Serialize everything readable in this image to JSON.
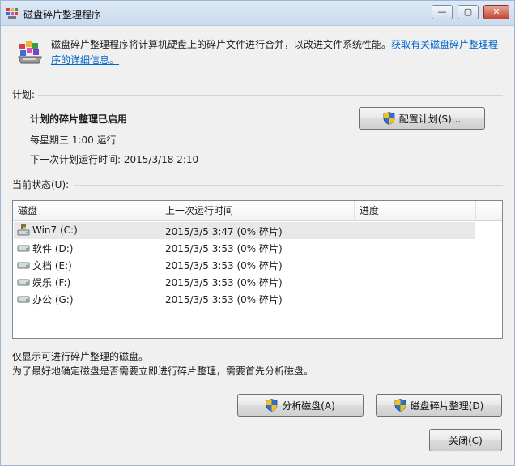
{
  "window": {
    "title": "磁盘碎片整理程序"
  },
  "caption": {
    "minimize": "—",
    "maximize": "▢",
    "close": "✕"
  },
  "description": {
    "text": "磁盘碎片整理程序将计算机硬盘上的碎片文件进行合并，以改进文件系统性能。",
    "link": "获取有关磁盘碎片整理程序的详细信息。"
  },
  "schedule": {
    "group_label": "计划:",
    "enabled_text": "计划的碎片整理已启用",
    "frequency": "每星期三  1:00 运行",
    "next_run": "下一次计划运行时间: 2015/3/18 2:10",
    "configure_button": "配置计划(S)..."
  },
  "status": {
    "group_label": "当前状态(U):",
    "columns": [
      "磁盘",
      "上一次运行时间",
      "进度"
    ],
    "rows": [
      {
        "name": "Win7 (C:)",
        "last_run": "2015/3/5 3:47 (0% 碎片)",
        "progress": "",
        "icon": "system-drive-icon"
      },
      {
        "name": "软件 (D:)",
        "last_run": "2015/3/5 3:53 (0% 碎片)",
        "progress": "",
        "icon": "hard-drive-icon"
      },
      {
        "name": "文档 (E:)",
        "last_run": "2015/3/5 3:53 (0% 碎片)",
        "progress": "",
        "icon": "hard-drive-icon"
      },
      {
        "name": "娱乐 (F:)",
        "last_run": "2015/3/5 3:53 (0% 碎片)",
        "progress": "",
        "icon": "hard-drive-icon"
      },
      {
        "name": "办公 (G:)",
        "last_run": "2015/3/5 3:53 (0% 碎片)",
        "progress": "",
        "icon": "hard-drive-icon"
      }
    ]
  },
  "footer": {
    "note1": "仅显示可进行碎片整理的磁盘。",
    "note2": "为了最好地确定磁盘是否需要立即进行碎片整理，需要首先分析磁盘。",
    "analyze_button": "分析磁盘(A)",
    "defrag_button": "磁盘碎片整理(D)",
    "close_button": "关闭(C)"
  },
  "colors": {
    "link": "#0066cc",
    "shield_blue": "#2f6fd0",
    "shield_yellow": "#f2c21a"
  }
}
